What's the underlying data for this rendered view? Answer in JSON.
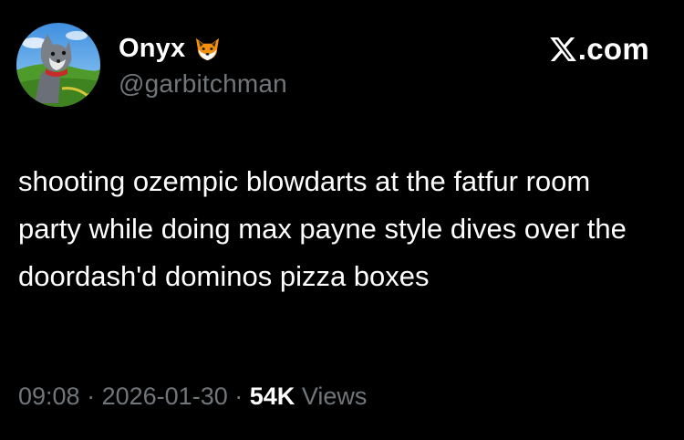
{
  "author": {
    "display_name": "Onyx",
    "badge_emoji_icon": "fox-face-emoji",
    "handle": "@garbitchman",
    "avatar_icon": "cartoon-wolf-avatar"
  },
  "brand": {
    "text": ".com",
    "logo_icon": "x-logo"
  },
  "tweet": {
    "text": "shooting ozempic blowdarts at the fatfur room party while doing max payne style dives over the doordash'd dominos pizza boxes"
  },
  "meta": {
    "time": "09:08",
    "separator": "·",
    "date": "2026-01-30",
    "views_count": "54K",
    "views_label": "Views"
  },
  "colors": {
    "background": "#000000",
    "primary_text": "#ffffff",
    "secondary_text": "#71767b"
  }
}
